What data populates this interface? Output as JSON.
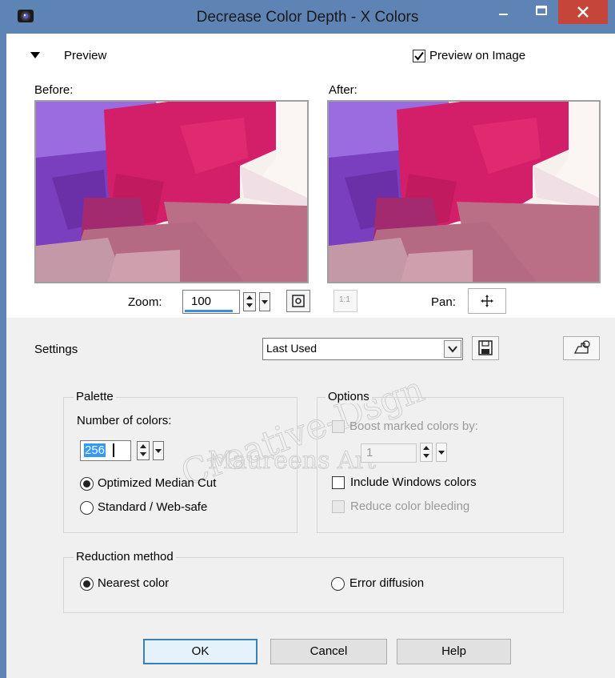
{
  "window": {
    "title": "Decrease Color Depth - X Colors",
    "title_bar_color": "#5e84b5",
    "close_color": "#c6453a"
  },
  "preview": {
    "section_label": "Preview",
    "preview_on_image_label": "Preview on Image",
    "preview_on_image_checked": true,
    "before_label": "Before:",
    "after_label": "After:",
    "zoom_label": "Zoom:",
    "zoom_value": "100",
    "one_to_one_label": "1:1",
    "pan_label": "Pan:"
  },
  "settings": {
    "label": "Settings",
    "preset_value": "Last Used"
  },
  "palette": {
    "legend": "Palette",
    "number_of_colors_label": "Number of colors:",
    "number_of_colors_value": "256",
    "optimized_median_cut_label": "Optimized Median Cut",
    "standard_web_safe_label": "Standard / Web-safe",
    "selected": "optimized_median_cut"
  },
  "options": {
    "legend": "Options",
    "boost_label": "Boost marked colors by:",
    "boost_value": "1",
    "include_windows_colors_label": "Include Windows colors",
    "reduce_color_bleeding_label": "Reduce color bleeding"
  },
  "reduction": {
    "legend": "Reduction method",
    "nearest_color_label": "Nearest color",
    "error_diffusion_label": "Error diffusion",
    "selected": "nearest_color"
  },
  "watermark": {
    "line1": "Creative-Dsgn",
    "line2": "Maureens Art"
  },
  "buttons": {
    "ok": "OK",
    "cancel": "Cancel",
    "help": "Help"
  }
}
